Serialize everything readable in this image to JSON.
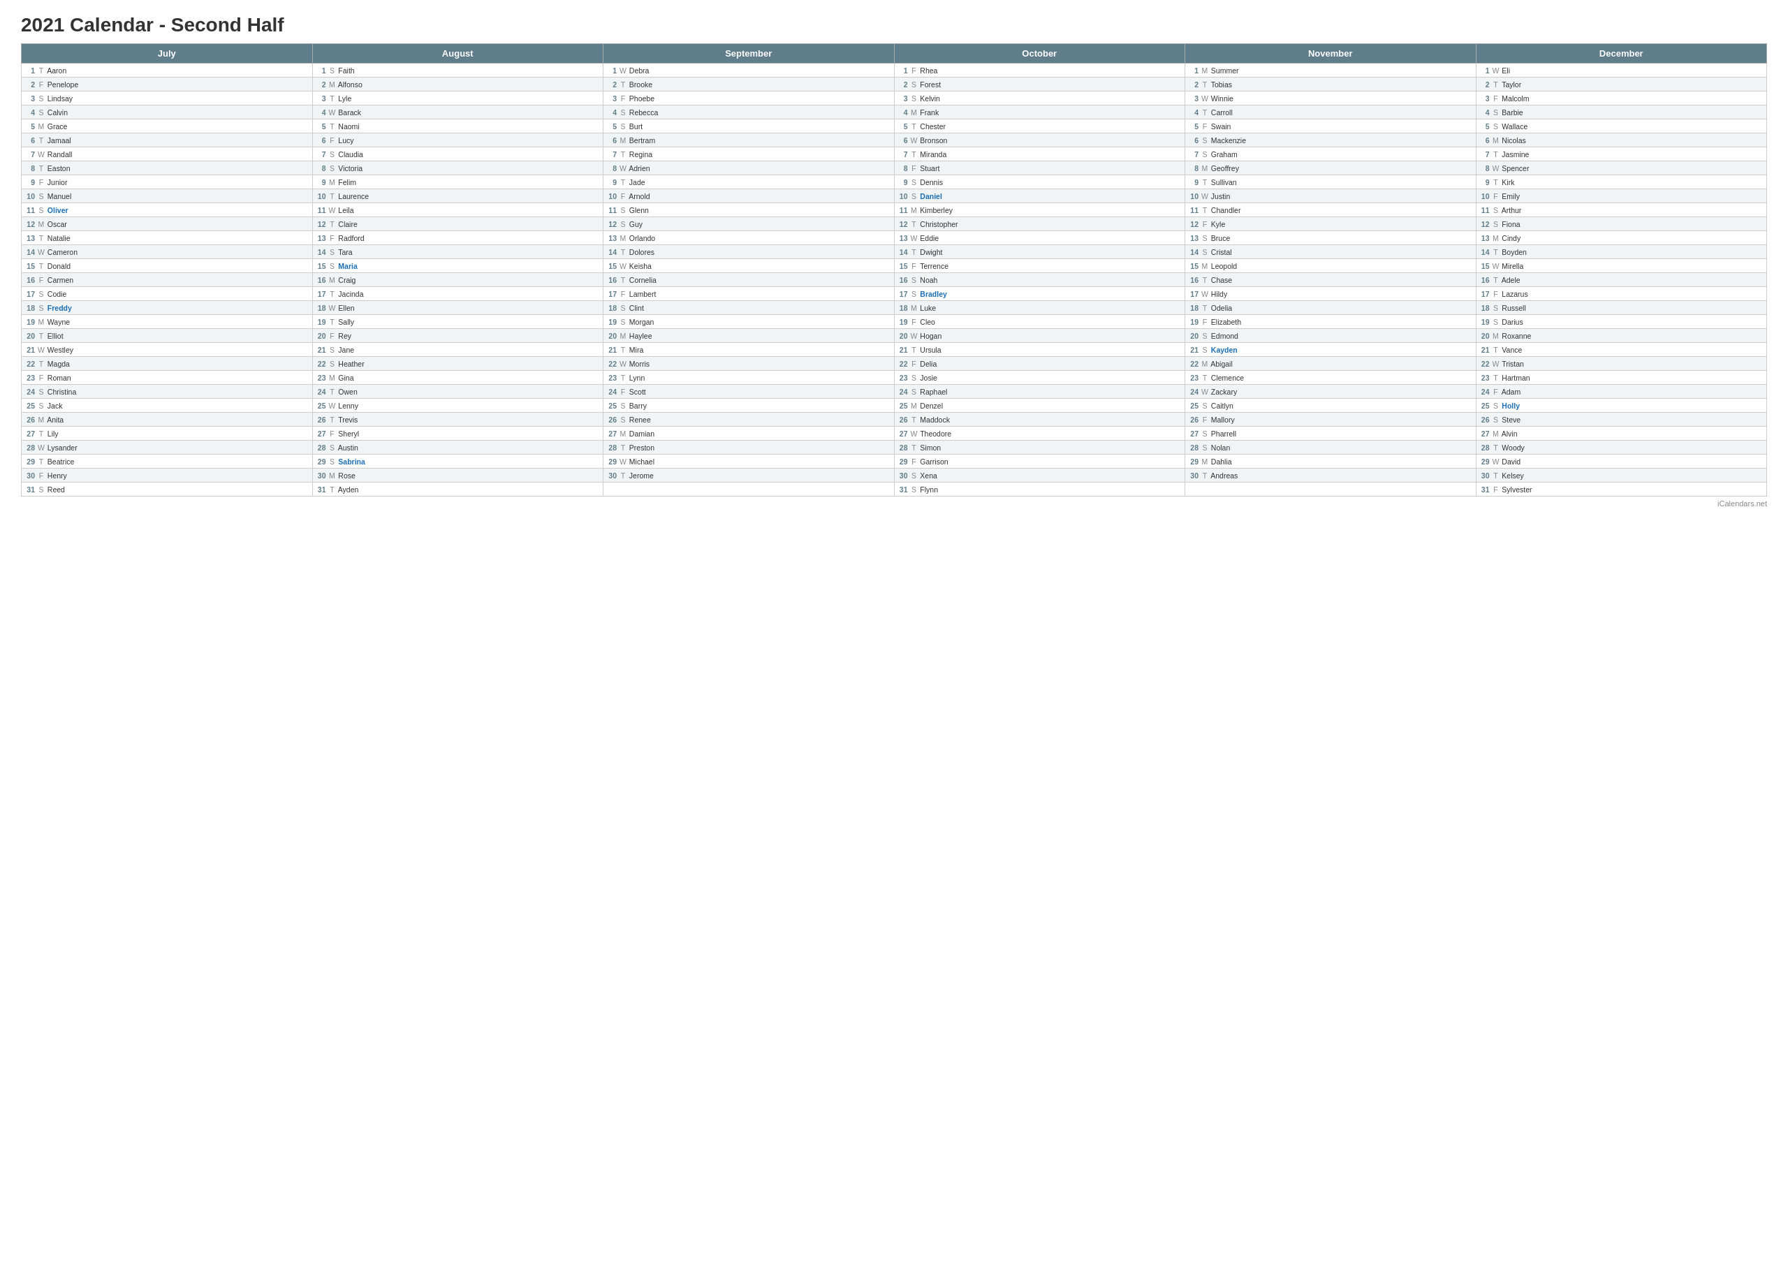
{
  "title": "2021 Calendar - Second Half",
  "footer": "iCalendars.net",
  "months": [
    {
      "name": "July",
      "days": [
        {
          "n": 1,
          "d": "T",
          "name": "Aaron"
        },
        {
          "n": 2,
          "d": "F",
          "name": "Penelope"
        },
        {
          "n": 3,
          "d": "S",
          "name": "Lindsay"
        },
        {
          "n": 4,
          "d": "S",
          "name": "Calvin"
        },
        {
          "n": 5,
          "d": "M",
          "name": "Grace"
        },
        {
          "n": 6,
          "d": "T",
          "name": "Jamaal"
        },
        {
          "n": 7,
          "d": "W",
          "name": "Randall"
        },
        {
          "n": 8,
          "d": "T",
          "name": "Easton"
        },
        {
          "n": 9,
          "d": "F",
          "name": "Junior"
        },
        {
          "n": 10,
          "d": "S",
          "name": "Manuel"
        },
        {
          "n": 11,
          "d": "S",
          "name": "Oliver",
          "highlight": true
        },
        {
          "n": 12,
          "d": "M",
          "name": "Oscar"
        },
        {
          "n": 13,
          "d": "T",
          "name": "Natalie"
        },
        {
          "n": 14,
          "d": "W",
          "name": "Cameron"
        },
        {
          "n": 15,
          "d": "T",
          "name": "Donald"
        },
        {
          "n": 16,
          "d": "F",
          "name": "Carmen"
        },
        {
          "n": 17,
          "d": "S",
          "name": "Codie"
        },
        {
          "n": 18,
          "d": "S",
          "name": "Freddy",
          "highlight": true
        },
        {
          "n": 19,
          "d": "M",
          "name": "Wayne"
        },
        {
          "n": 20,
          "d": "T",
          "name": "Elliot"
        },
        {
          "n": 21,
          "d": "W",
          "name": "Westley"
        },
        {
          "n": 22,
          "d": "T",
          "name": "Magda"
        },
        {
          "n": 23,
          "d": "F",
          "name": "Roman"
        },
        {
          "n": 24,
          "d": "S",
          "name": "Christina"
        },
        {
          "n": 25,
          "d": "S",
          "name": "Jack"
        },
        {
          "n": 26,
          "d": "M",
          "name": "Anita"
        },
        {
          "n": 27,
          "d": "T",
          "name": "Lily"
        },
        {
          "n": 28,
          "d": "W",
          "name": "Lysander"
        },
        {
          "n": 29,
          "d": "T",
          "name": "Beatrice"
        },
        {
          "n": 30,
          "d": "F",
          "name": "Henry"
        },
        {
          "n": 31,
          "d": "S",
          "name": "Reed"
        }
      ]
    },
    {
      "name": "August",
      "days": [
        {
          "n": 1,
          "d": "S",
          "name": "Faith"
        },
        {
          "n": 2,
          "d": "M",
          "name": "Alfonso"
        },
        {
          "n": 3,
          "d": "T",
          "name": "Lyle"
        },
        {
          "n": 4,
          "d": "W",
          "name": "Barack"
        },
        {
          "n": 5,
          "d": "T",
          "name": "Naomi"
        },
        {
          "n": 6,
          "d": "F",
          "name": "Lucy"
        },
        {
          "n": 7,
          "d": "S",
          "name": "Claudia"
        },
        {
          "n": 8,
          "d": "S",
          "name": "Victoria"
        },
        {
          "n": 9,
          "d": "M",
          "name": "Felim"
        },
        {
          "n": 10,
          "d": "T",
          "name": "Laurence"
        },
        {
          "n": 11,
          "d": "W",
          "name": "Leila"
        },
        {
          "n": 12,
          "d": "T",
          "name": "Claire"
        },
        {
          "n": 13,
          "d": "F",
          "name": "Radford"
        },
        {
          "n": 14,
          "d": "S",
          "name": "Tara"
        },
        {
          "n": 15,
          "d": "S",
          "name": "Maria",
          "highlight": true
        },
        {
          "n": 16,
          "d": "M",
          "name": "Craig"
        },
        {
          "n": 17,
          "d": "T",
          "name": "Jacinda"
        },
        {
          "n": 18,
          "d": "W",
          "name": "Ellen"
        },
        {
          "n": 19,
          "d": "T",
          "name": "Sally"
        },
        {
          "n": 20,
          "d": "F",
          "name": "Rey"
        },
        {
          "n": 21,
          "d": "S",
          "name": "Jane"
        },
        {
          "n": 22,
          "d": "S",
          "name": "Heather"
        },
        {
          "n": 23,
          "d": "M",
          "name": "Gina"
        },
        {
          "n": 24,
          "d": "T",
          "name": "Owen"
        },
        {
          "n": 25,
          "d": "W",
          "name": "Lenny"
        },
        {
          "n": 26,
          "d": "T",
          "name": "Trevis"
        },
        {
          "n": 27,
          "d": "F",
          "name": "Sheryl"
        },
        {
          "n": 28,
          "d": "S",
          "name": "Austin"
        },
        {
          "n": 29,
          "d": "S",
          "name": "Sabrina",
          "highlight": true
        },
        {
          "n": 30,
          "d": "M",
          "name": "Rose"
        },
        {
          "n": 31,
          "d": "T",
          "name": "Ayden"
        }
      ]
    },
    {
      "name": "September",
      "days": [
        {
          "n": 1,
          "d": "W",
          "name": "Debra"
        },
        {
          "n": 2,
          "d": "T",
          "name": "Brooke"
        },
        {
          "n": 3,
          "d": "F",
          "name": "Phoebe"
        },
        {
          "n": 4,
          "d": "S",
          "name": "Rebecca"
        },
        {
          "n": 5,
          "d": "S",
          "name": "Burt"
        },
        {
          "n": 6,
          "d": "M",
          "name": "Bertram"
        },
        {
          "n": 7,
          "d": "T",
          "name": "Regina"
        },
        {
          "n": 8,
          "d": "W",
          "name": "Adrien"
        },
        {
          "n": 9,
          "d": "T",
          "name": "Jade"
        },
        {
          "n": 10,
          "d": "F",
          "name": "Arnold"
        },
        {
          "n": 11,
          "d": "S",
          "name": "Glenn"
        },
        {
          "n": 12,
          "d": "S",
          "name": "Guy"
        },
        {
          "n": 13,
          "d": "M",
          "name": "Orlando"
        },
        {
          "n": 14,
          "d": "T",
          "name": "Dolores"
        },
        {
          "n": 15,
          "d": "W",
          "name": "Keisha"
        },
        {
          "n": 16,
          "d": "T",
          "name": "Cornelia"
        },
        {
          "n": 17,
          "d": "F",
          "name": "Lambert"
        },
        {
          "n": 18,
          "d": "S",
          "name": "Clint"
        },
        {
          "n": 19,
          "d": "S",
          "name": "Morgan"
        },
        {
          "n": 20,
          "d": "M",
          "name": "Haylee"
        },
        {
          "n": 21,
          "d": "T",
          "name": "Mira"
        },
        {
          "n": 22,
          "d": "W",
          "name": "Morris"
        },
        {
          "n": 23,
          "d": "T",
          "name": "Lynn"
        },
        {
          "n": 24,
          "d": "F",
          "name": "Scott"
        },
        {
          "n": 25,
          "d": "S",
          "name": "Barry"
        },
        {
          "n": 26,
          "d": "S",
          "name": "Renee"
        },
        {
          "n": 27,
          "d": "M",
          "name": "Damian"
        },
        {
          "n": 28,
          "d": "T",
          "name": "Preston"
        },
        {
          "n": 29,
          "d": "W",
          "name": "Michael"
        },
        {
          "n": 30,
          "d": "T",
          "name": "Jerome"
        }
      ]
    },
    {
      "name": "October",
      "days": [
        {
          "n": 1,
          "d": "F",
          "name": "Rhea"
        },
        {
          "n": 2,
          "d": "S",
          "name": "Forest"
        },
        {
          "n": 3,
          "d": "S",
          "name": "Kelvin"
        },
        {
          "n": 4,
          "d": "M",
          "name": "Frank"
        },
        {
          "n": 5,
          "d": "T",
          "name": "Chester"
        },
        {
          "n": 6,
          "d": "W",
          "name": "Bronson"
        },
        {
          "n": 7,
          "d": "T",
          "name": "Miranda"
        },
        {
          "n": 8,
          "d": "F",
          "name": "Stuart"
        },
        {
          "n": 9,
          "d": "S",
          "name": "Dennis"
        },
        {
          "n": 10,
          "d": "S",
          "name": "Daniel",
          "highlight": true
        },
        {
          "n": 11,
          "d": "M",
          "name": "Kimberley"
        },
        {
          "n": 12,
          "d": "T",
          "name": "Christopher"
        },
        {
          "n": 13,
          "d": "W",
          "name": "Eddie"
        },
        {
          "n": 14,
          "d": "T",
          "name": "Dwight"
        },
        {
          "n": 15,
          "d": "F",
          "name": "Terrence"
        },
        {
          "n": 16,
          "d": "S",
          "name": "Noah"
        },
        {
          "n": 17,
          "d": "S",
          "name": "Bradley",
          "highlight": true
        },
        {
          "n": 18,
          "d": "M",
          "name": "Luke"
        },
        {
          "n": 19,
          "d": "F",
          "name": "Cleo"
        },
        {
          "n": 20,
          "d": "W",
          "name": "Hogan"
        },
        {
          "n": 21,
          "d": "T",
          "name": "Ursula"
        },
        {
          "n": 22,
          "d": "F",
          "name": "Delia"
        },
        {
          "n": 23,
          "d": "S",
          "name": "Josie"
        },
        {
          "n": 24,
          "d": "S",
          "name": "Raphael"
        },
        {
          "n": 25,
          "d": "M",
          "name": "Denzel"
        },
        {
          "n": 26,
          "d": "T",
          "name": "Maddock"
        },
        {
          "n": 27,
          "d": "W",
          "name": "Theodore"
        },
        {
          "n": 28,
          "d": "T",
          "name": "Simon"
        },
        {
          "n": 29,
          "d": "F",
          "name": "Garrison"
        },
        {
          "n": 30,
          "d": "S",
          "name": "Xena"
        },
        {
          "n": 31,
          "d": "S",
          "name": "Flynn"
        }
      ]
    },
    {
      "name": "November",
      "days": [
        {
          "n": 1,
          "d": "M",
          "name": "Summer"
        },
        {
          "n": 2,
          "d": "T",
          "name": "Tobias"
        },
        {
          "n": 3,
          "d": "W",
          "name": "Winnie"
        },
        {
          "n": 4,
          "d": "T",
          "name": "Carroll"
        },
        {
          "n": 5,
          "d": "F",
          "name": "Swain"
        },
        {
          "n": 6,
          "d": "S",
          "name": "Mackenzie"
        },
        {
          "n": 7,
          "d": "S",
          "name": "Graham"
        },
        {
          "n": 8,
          "d": "M",
          "name": "Geoffrey"
        },
        {
          "n": 9,
          "d": "T",
          "name": "Sullivan"
        },
        {
          "n": 10,
          "d": "W",
          "name": "Justin"
        },
        {
          "n": 11,
          "d": "T",
          "name": "Chandler"
        },
        {
          "n": 12,
          "d": "F",
          "name": "Kyle"
        },
        {
          "n": 13,
          "d": "S",
          "name": "Bruce"
        },
        {
          "n": 14,
          "d": "S",
          "name": "Cristal"
        },
        {
          "n": 15,
          "d": "M",
          "name": "Leopold"
        },
        {
          "n": 16,
          "d": "T",
          "name": "Chase"
        },
        {
          "n": 17,
          "d": "W",
          "name": "Hildy"
        },
        {
          "n": 18,
          "d": "T",
          "name": "Odelia"
        },
        {
          "n": 19,
          "d": "F",
          "name": "Elizabeth"
        },
        {
          "n": 20,
          "d": "S",
          "name": "Edmond"
        },
        {
          "n": 21,
          "d": "S",
          "name": "Kayden",
          "highlight": true
        },
        {
          "n": 22,
          "d": "M",
          "name": "Abigail"
        },
        {
          "n": 23,
          "d": "T",
          "name": "Clemence"
        },
        {
          "n": 24,
          "d": "W",
          "name": "Zackary"
        },
        {
          "n": 25,
          "d": "S",
          "name": "Caitlyn"
        },
        {
          "n": 26,
          "d": "F",
          "name": "Mallory"
        },
        {
          "n": 27,
          "d": "S",
          "name": "Pharrell"
        },
        {
          "n": 28,
          "d": "S",
          "name": "Nolan"
        },
        {
          "n": 29,
          "d": "M",
          "name": "Dahlia"
        },
        {
          "n": 30,
          "d": "T",
          "name": "Andreas"
        }
      ]
    },
    {
      "name": "December",
      "days": [
        {
          "n": 1,
          "d": "W",
          "name": "Eli"
        },
        {
          "n": 2,
          "d": "T",
          "name": "Taylor"
        },
        {
          "n": 3,
          "d": "F",
          "name": "Malcolm"
        },
        {
          "n": 4,
          "d": "S",
          "name": "Barbie"
        },
        {
          "n": 5,
          "d": "S",
          "name": "Wallace"
        },
        {
          "n": 6,
          "d": "M",
          "name": "Nicolas"
        },
        {
          "n": 7,
          "d": "T",
          "name": "Jasmine"
        },
        {
          "n": 8,
          "d": "W",
          "name": "Spencer"
        },
        {
          "n": 9,
          "d": "T",
          "name": "Kirk"
        },
        {
          "n": 10,
          "d": "F",
          "name": "Emily"
        },
        {
          "n": 11,
          "d": "S",
          "name": "Arthur"
        },
        {
          "n": 12,
          "d": "S",
          "name": "Fiona"
        },
        {
          "n": 13,
          "d": "M",
          "name": "Cindy"
        },
        {
          "n": 14,
          "d": "T",
          "name": "Boyden"
        },
        {
          "n": 15,
          "d": "W",
          "name": "Mirella"
        },
        {
          "n": 16,
          "d": "T",
          "name": "Adele"
        },
        {
          "n": 17,
          "d": "F",
          "name": "Lazarus"
        },
        {
          "n": 18,
          "d": "S",
          "name": "Russell"
        },
        {
          "n": 19,
          "d": "S",
          "name": "Darius"
        },
        {
          "n": 20,
          "d": "M",
          "name": "Roxanne"
        },
        {
          "n": 21,
          "d": "T",
          "name": "Vance"
        },
        {
          "n": 22,
          "d": "W",
          "name": "Tristan"
        },
        {
          "n": 23,
          "d": "T",
          "name": "Hartman"
        },
        {
          "n": 24,
          "d": "F",
          "name": "Adam"
        },
        {
          "n": 25,
          "d": "S",
          "name": "Holly",
          "highlight": true
        },
        {
          "n": 26,
          "d": "S",
          "name": "Steve"
        },
        {
          "n": 27,
          "d": "M",
          "name": "Alvin"
        },
        {
          "n": 28,
          "d": "T",
          "name": "Woody"
        },
        {
          "n": 29,
          "d": "W",
          "name": "David"
        },
        {
          "n": 30,
          "d": "T",
          "name": "Kelsey"
        },
        {
          "n": 31,
          "d": "F",
          "name": "Sylvester"
        }
      ]
    }
  ]
}
